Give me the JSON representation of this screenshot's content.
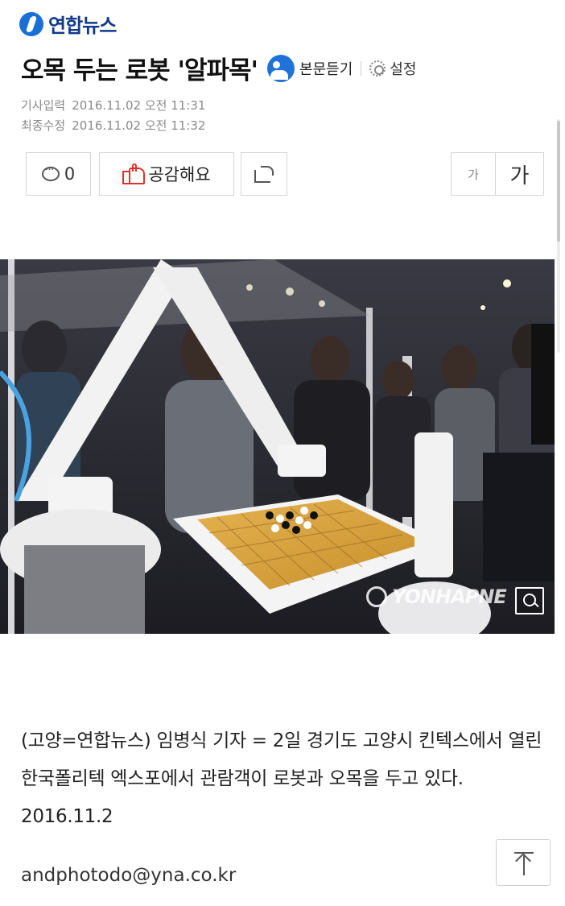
{
  "header": {
    "brand": "연합뉴스"
  },
  "article": {
    "headline": "오목 두는 로봇 '알파목'",
    "listen_label": "본문듣기",
    "settings_label": "설정",
    "published_label": "기사입력",
    "published_value": "2016.11.02 오전 11:31",
    "modified_label": "최종수정",
    "modified_value": "2016.11.02 오전 11:32",
    "body": "(고양=연합뉴스) 임병식 기자 = 2일 경기도 고양시 킨텍스에서 열린 한국폴리텍 엑스포에서 관람객이 로봇과 오목을 두고 있다. 2016.11.2",
    "email": "andphotodo@yna.co.kr"
  },
  "actions": {
    "comment_count": "0",
    "like_label": "공감해요",
    "font_small": "가",
    "font_large": "가"
  },
  "photo": {
    "watermark": "YONHAPNE"
  },
  "icons": [
    "brand-logo-icon",
    "listen-icon",
    "gear-icon",
    "comment-icon",
    "like-icon",
    "share-icon",
    "zoom-icon",
    "scroll-top-icon"
  ],
  "colors": {
    "brand_blue": "#1a6fd6",
    "like_red": "#e0312e",
    "border_gray": "#d6d6d6"
  }
}
